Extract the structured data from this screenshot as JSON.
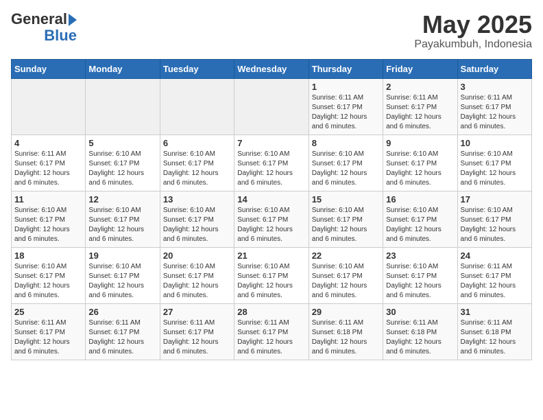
{
  "logo": {
    "general": "General",
    "blue": "Blue"
  },
  "title": "May 2025",
  "subtitle": "Payakumbuh, Indonesia",
  "days_of_week": [
    "Sunday",
    "Monday",
    "Tuesday",
    "Wednesday",
    "Thursday",
    "Friday",
    "Saturday"
  ],
  "weeks": [
    [
      {
        "num": "",
        "info": ""
      },
      {
        "num": "",
        "info": ""
      },
      {
        "num": "",
        "info": ""
      },
      {
        "num": "",
        "info": ""
      },
      {
        "num": "1",
        "info": "Sunrise: 6:11 AM\nSunset: 6:17 PM\nDaylight: 12 hours and 6 minutes."
      },
      {
        "num": "2",
        "info": "Sunrise: 6:11 AM\nSunset: 6:17 PM\nDaylight: 12 hours and 6 minutes."
      },
      {
        "num": "3",
        "info": "Sunrise: 6:11 AM\nSunset: 6:17 PM\nDaylight: 12 hours and 6 minutes."
      }
    ],
    [
      {
        "num": "4",
        "info": "Sunrise: 6:11 AM\nSunset: 6:17 PM\nDaylight: 12 hours and 6 minutes."
      },
      {
        "num": "5",
        "info": "Sunrise: 6:10 AM\nSunset: 6:17 PM\nDaylight: 12 hours and 6 minutes."
      },
      {
        "num": "6",
        "info": "Sunrise: 6:10 AM\nSunset: 6:17 PM\nDaylight: 12 hours and 6 minutes."
      },
      {
        "num": "7",
        "info": "Sunrise: 6:10 AM\nSunset: 6:17 PM\nDaylight: 12 hours and 6 minutes."
      },
      {
        "num": "8",
        "info": "Sunrise: 6:10 AM\nSunset: 6:17 PM\nDaylight: 12 hours and 6 minutes."
      },
      {
        "num": "9",
        "info": "Sunrise: 6:10 AM\nSunset: 6:17 PM\nDaylight: 12 hours and 6 minutes."
      },
      {
        "num": "10",
        "info": "Sunrise: 6:10 AM\nSunset: 6:17 PM\nDaylight: 12 hours and 6 minutes."
      }
    ],
    [
      {
        "num": "11",
        "info": "Sunrise: 6:10 AM\nSunset: 6:17 PM\nDaylight: 12 hours and 6 minutes."
      },
      {
        "num": "12",
        "info": "Sunrise: 6:10 AM\nSunset: 6:17 PM\nDaylight: 12 hours and 6 minutes."
      },
      {
        "num": "13",
        "info": "Sunrise: 6:10 AM\nSunset: 6:17 PM\nDaylight: 12 hours and 6 minutes."
      },
      {
        "num": "14",
        "info": "Sunrise: 6:10 AM\nSunset: 6:17 PM\nDaylight: 12 hours and 6 minutes."
      },
      {
        "num": "15",
        "info": "Sunrise: 6:10 AM\nSunset: 6:17 PM\nDaylight: 12 hours and 6 minutes."
      },
      {
        "num": "16",
        "info": "Sunrise: 6:10 AM\nSunset: 6:17 PM\nDaylight: 12 hours and 6 minutes."
      },
      {
        "num": "17",
        "info": "Sunrise: 6:10 AM\nSunset: 6:17 PM\nDaylight: 12 hours and 6 minutes."
      }
    ],
    [
      {
        "num": "18",
        "info": "Sunrise: 6:10 AM\nSunset: 6:17 PM\nDaylight: 12 hours and 6 minutes."
      },
      {
        "num": "19",
        "info": "Sunrise: 6:10 AM\nSunset: 6:17 PM\nDaylight: 12 hours and 6 minutes."
      },
      {
        "num": "20",
        "info": "Sunrise: 6:10 AM\nSunset: 6:17 PM\nDaylight: 12 hours and 6 minutes."
      },
      {
        "num": "21",
        "info": "Sunrise: 6:10 AM\nSunset: 6:17 PM\nDaylight: 12 hours and 6 minutes."
      },
      {
        "num": "22",
        "info": "Sunrise: 6:10 AM\nSunset: 6:17 PM\nDaylight: 12 hours and 6 minutes."
      },
      {
        "num": "23",
        "info": "Sunrise: 6:10 AM\nSunset: 6:17 PM\nDaylight: 12 hours and 6 minutes."
      },
      {
        "num": "24",
        "info": "Sunrise: 6:11 AM\nSunset: 6:17 PM\nDaylight: 12 hours and 6 minutes."
      }
    ],
    [
      {
        "num": "25",
        "info": "Sunrise: 6:11 AM\nSunset: 6:17 PM\nDaylight: 12 hours and 6 minutes."
      },
      {
        "num": "26",
        "info": "Sunrise: 6:11 AM\nSunset: 6:17 PM\nDaylight: 12 hours and 6 minutes."
      },
      {
        "num": "27",
        "info": "Sunrise: 6:11 AM\nSunset: 6:17 PM\nDaylight: 12 hours and 6 minutes."
      },
      {
        "num": "28",
        "info": "Sunrise: 6:11 AM\nSunset: 6:17 PM\nDaylight: 12 hours and 6 minutes."
      },
      {
        "num": "29",
        "info": "Sunrise: 6:11 AM\nSunset: 6:18 PM\nDaylight: 12 hours and 6 minutes."
      },
      {
        "num": "30",
        "info": "Sunrise: 6:11 AM\nSunset: 6:18 PM\nDaylight: 12 hours and 6 minutes."
      },
      {
        "num": "31",
        "info": "Sunrise: 6:11 AM\nSunset: 6:18 PM\nDaylight: 12 hours and 6 minutes."
      }
    ]
  ]
}
